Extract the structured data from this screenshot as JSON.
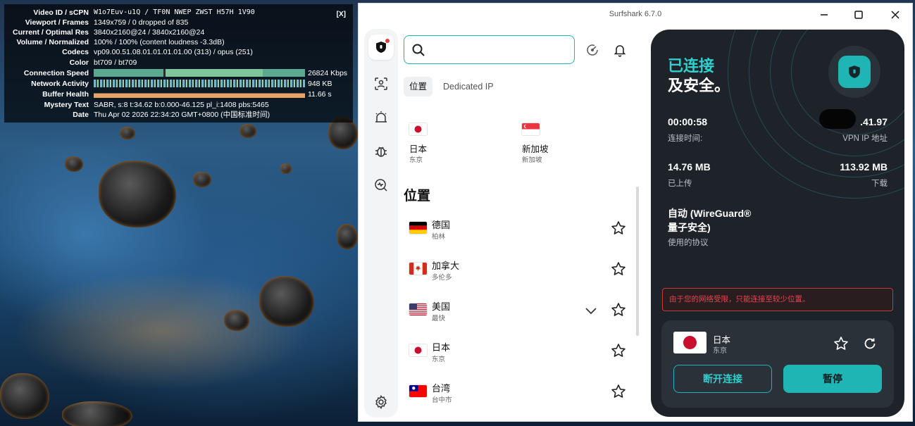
{
  "stats": {
    "close_label": "[X]",
    "rows": [
      {
        "key": "Video ID / sCPN",
        "value": "W1o7Euv-u1Q / TF0N NWEP ZWST H57H 1V90"
      },
      {
        "key": "Viewport / Frames",
        "value": "1349x759 / 0 dropped of 835"
      },
      {
        "key": "Current / Optimal Res",
        "value": "3840x2160@24 / 3840x2160@24"
      },
      {
        "key": "Volume / Normalized",
        "value": "100% / 100% (content loudness -3.3dB)"
      },
      {
        "key": "Codecs",
        "value": "vp09.00.51.08.01.01.01.01.00 (313) / opus (251)"
      },
      {
        "key": "Color",
        "value": "bt709 / bt709"
      },
      {
        "key": "Connection Speed",
        "value": "26824 Kbps"
      },
      {
        "key": "Network Activity",
        "value": "948 KB"
      },
      {
        "key": "Buffer Health",
        "value": "11.66 s"
      },
      {
        "key": "Mystery Text",
        "value": "SABR, s:8 t:34.62 b:0.000-46.125 pl_i:1408 pbs:5465"
      },
      {
        "key": "Date",
        "value": "Thu Apr 02 2026 22:34:20 GMT+0800 (中国标准时间)"
      }
    ]
  },
  "window": {
    "title": "Surfshark 6.7.0"
  },
  "search": {
    "value": "",
    "placeholder": ""
  },
  "tabs": [
    {
      "label": "位置",
      "active": true
    },
    {
      "label": "Dedicated IP",
      "active": false
    }
  ],
  "recent": [
    {
      "country": "日本",
      "city": "东京",
      "flag": "jp"
    },
    {
      "country": "新加坡",
      "city": "新加坡",
      "flag": "sg"
    }
  ],
  "locations_header": "位置",
  "locations": [
    {
      "country": "德国",
      "city": "柏林",
      "flag": "de",
      "expandable": false
    },
    {
      "country": "加拿大",
      "city": "多伦多",
      "flag": "ca",
      "expandable": false
    },
    {
      "country": "美国",
      "city": "最快",
      "flag": "us",
      "expandable": true
    },
    {
      "country": "日本",
      "city": "东京",
      "flag": "jp",
      "expandable": false
    },
    {
      "country": "台湾",
      "city": "台中市",
      "flag": "tw",
      "expandable": false
    }
  ],
  "status": {
    "line1": "已连接",
    "line2": "及安全。",
    "time_value": "00:00:58",
    "time_label": "连接时间:",
    "ip_value": ".41.97",
    "ip_label": "VPN IP 地址",
    "upload_value": "14.76 MB",
    "upload_label": "已上传",
    "download_value": "113.92 MB",
    "download_label": "下载",
    "protocol_value_line1": "自动 (WireGuard®",
    "protocol_value_line2": "量子安全)",
    "protocol_label": "使用的协议",
    "warning": "由于您的网络受限，只能连接至较少位置。"
  },
  "connection": {
    "country": "日本",
    "city": "东京",
    "disconnect_label": "断开连接",
    "pause_label": "暂停"
  },
  "colors": {
    "accent": "#1fb5b5",
    "accent_text": "#2fd0cd",
    "panel": "#1d2329",
    "card": "#2a3138",
    "warning": "#e2464f"
  }
}
